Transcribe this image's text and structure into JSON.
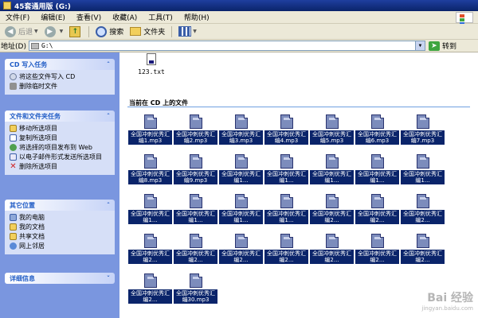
{
  "window": {
    "title": "45套通用版 (G:)"
  },
  "menu": [
    "文件(F)",
    "编辑(E)",
    "查看(V)",
    "收藏(A)",
    "工具(T)",
    "帮助(H)"
  ],
  "toolbar": {
    "back": "后退",
    "search": "搜索",
    "folders": "文件夹"
  },
  "address": {
    "label": "地址(D)",
    "value": "G:\\",
    "go": "转到"
  },
  "sidebar": {
    "cd": {
      "title": "CD 写入任务",
      "items": [
        "将这些文件写入 CD",
        "删除临时文件"
      ]
    },
    "tasks": {
      "title": "文件和文件夹任务",
      "items": [
        "移动所选项目",
        "复制所选项目",
        "将选择的项目发布到 Web",
        "以电子邮件形式发送所选项目",
        "删除所选项目"
      ]
    },
    "places": {
      "title": "其它位置",
      "items": [
        "我的电脑",
        "我的文档",
        "共享文档",
        "网上邻居"
      ]
    },
    "details": {
      "title": "详细信息"
    }
  },
  "content": {
    "top_file": "123.txt",
    "section_title": "当前在 CD 上的文件",
    "files": [
      "全国冲刺优秀汇编1.mp3",
      "全国冲刺优秀汇编2.mp3",
      "全国冲刺优秀汇编3.mp3",
      "全国冲刺优秀汇编4.mp3",
      "全国冲刺优秀汇编5.mp3",
      "全国冲刺优秀汇编6.mp3",
      "全国冲刺优秀汇编7.mp3",
      "全国冲刺优秀汇编8.mp3",
      "全国冲刺优秀汇编9.mp3",
      "全国冲刺优秀汇编1...",
      "全国冲刺优秀汇编1...",
      "全国冲刺优秀汇编1...",
      "全国冲刺优秀汇编1...",
      "全国冲刺优秀汇编1...",
      "全国冲刺优秀汇编1...",
      "全国冲刺优秀汇编1...",
      "全国冲刺优秀汇编1...",
      "全国冲刺优秀汇编1...",
      "全国冲刺优秀汇编2...",
      "全国冲刺优秀汇编2...",
      "全国冲刺优秀汇编2...",
      "全国冲刺优秀汇编2...",
      "全国冲刺优秀汇编2...",
      "全国冲刺优秀汇编2...",
      "全国冲刺优秀汇编2...",
      "全国冲刺优秀汇编2...",
      "全国冲刺优秀汇编2...",
      "全国冲刺优秀汇编2...",
      "全国冲刺优秀汇编2...",
      "全国冲刺优秀汇编30.mp3"
    ]
  },
  "watermark": {
    "brand": "Bai 经验",
    "url": "jingyan.baidu.com"
  },
  "colors": {
    "title_bar": "#0a246a",
    "sidebar": "#7a96df",
    "selection": "#0a246a"
  }
}
